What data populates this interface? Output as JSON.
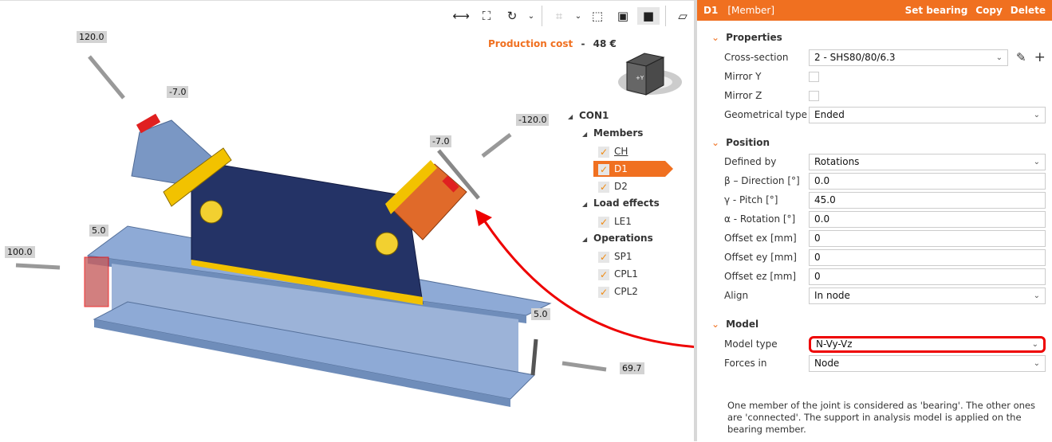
{
  "toolbar": {
    "icons": [
      "ruler-icon",
      "fit-screen-icon",
      "rotate-icon",
      "chevron-down-icon",
      "crop-icon",
      "chevron-down-icon",
      "wireframe-cube-icon",
      "transparent-cube-icon",
      "solid-cube-icon",
      "member-icon",
      "mirror-icon",
      "home-icon"
    ]
  },
  "cost": {
    "label": "Production cost",
    "separator": "-",
    "value": "48 €"
  },
  "view_cube": {
    "label": "+Y"
  },
  "load_labels": [
    "120.0",
    "-7.0",
    "-120.0",
    "-7.0",
    "5.0",
    "100.0",
    "5.0",
    "69.7"
  ],
  "tree": {
    "root": "CON1",
    "groups": [
      {
        "label": "Members",
        "items": [
          "CH",
          "D1",
          "D2"
        ]
      },
      {
        "label": "Load effects",
        "items": [
          "LE1"
        ]
      },
      {
        "label": "Operations",
        "items": [
          "SP1",
          "CPL1",
          "CPL2"
        ]
      }
    ],
    "selected": "D1"
  },
  "panel": {
    "id": "D1",
    "type": "[Member]",
    "actions": {
      "set_bearing": "Set bearing",
      "copy": "Copy",
      "delete": "Delete"
    },
    "properties": {
      "title": "Properties",
      "cross_section_label": "Cross-section",
      "cross_section": "2 - SHS80/80/6.3",
      "mirror_y_label": "Mirror Y",
      "mirror_y": false,
      "mirror_z_label": "Mirror Z",
      "mirror_z": false,
      "geom_type_label": "Geometrical type",
      "geom_type": "Ended"
    },
    "position": {
      "title": "Position",
      "rows": [
        {
          "label": "Defined by",
          "value": "Rotations",
          "dropdown": true
        },
        {
          "label": "β – Direction [°]",
          "value": "0.0"
        },
        {
          "label": "γ - Pitch [°]",
          "value": "45.0"
        },
        {
          "label": "α - Rotation [°]",
          "value": "0.0"
        },
        {
          "label": "Offset ex [mm]",
          "value": "0"
        },
        {
          "label": "Offset ey [mm]",
          "value": "0"
        },
        {
          "label": "Offset ez [mm]",
          "value": "0"
        },
        {
          "label": "Align",
          "value": "In node",
          "dropdown": true
        }
      ]
    },
    "model": {
      "title": "Model",
      "model_type_label": "Model type",
      "model_type": "N-Vy-Vz",
      "forces_in_label": "Forces in",
      "forces_in": "Node"
    },
    "note": "One member of the joint is considered as 'bearing'. The other ones are 'connected'. The support in analysis model is applied on the bearing member."
  },
  "colors": {
    "accent": "#f07020",
    "highlight": "#e00000",
    "steel_blue": "#7e9cc8",
    "plate_navy": "#243366",
    "weld": "#f2c200"
  }
}
